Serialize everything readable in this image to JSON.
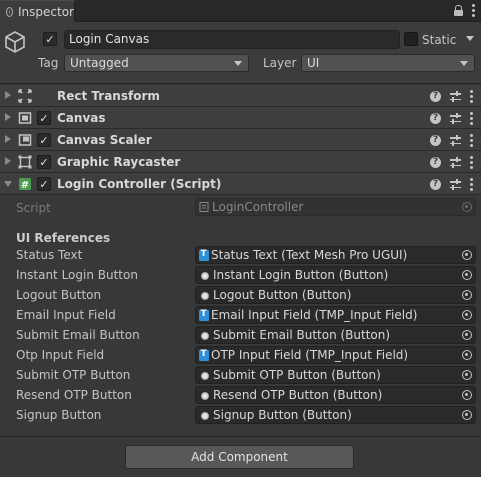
{
  "window": {
    "tab_title": "Inspector"
  },
  "header": {
    "object_name": "Login Canvas",
    "object_active": true,
    "static_label": "Static",
    "static_checked": false,
    "tag_label": "Tag",
    "tag_value": "Untagged",
    "layer_label": "Layer",
    "layer_value": "UI"
  },
  "components": [
    {
      "name": "Rect Transform",
      "icon": "rect-transform-icon",
      "has_checkbox": false,
      "expanded": false
    },
    {
      "name": "Canvas",
      "icon": "canvas-icon",
      "has_checkbox": true,
      "expanded": false
    },
    {
      "name": "Canvas Scaler",
      "icon": "canvas-scaler-icon",
      "has_checkbox": true,
      "expanded": false
    },
    {
      "name": "Graphic Raycaster",
      "icon": "graphic-raycaster-icon",
      "has_checkbox": true,
      "expanded": false
    },
    {
      "name": "Login Controller (Script)",
      "icon": "script-icon",
      "has_checkbox": true,
      "expanded": true
    }
  ],
  "script": {
    "label": "Script",
    "value": "LoginController"
  },
  "ui_references": {
    "title": "UI References",
    "fields": [
      {
        "label": "Status Text",
        "value": "Status Text (Text Mesh Pro UGUI)",
        "icon": "tmp-text-icon"
      },
      {
        "label": "Instant Login Button",
        "value": "Instant Login Button (Button)",
        "icon": "button-icon"
      },
      {
        "label": "Logout Button",
        "value": "Logout Button (Button)",
        "icon": "button-icon"
      },
      {
        "label": "Email Input Field",
        "value": "Email Input Field (TMP_Input Field)",
        "icon": "tmp-text-icon"
      },
      {
        "label": "Submit Email Button",
        "value": "Submit Email Button (Button)",
        "icon": "button-icon"
      },
      {
        "label": "Otp Input Field",
        "value": "OTP Input Field (TMP_Input Field)",
        "icon": "tmp-text-icon"
      },
      {
        "label": "Submit OTP Button",
        "value": "Submit OTP Button (Button)",
        "icon": "button-icon"
      },
      {
        "label": "Resend OTP Button",
        "value": "Resend OTP Button (Button)",
        "icon": "button-icon"
      },
      {
        "label": "Signup Button",
        "value": "Signup Button (Button)",
        "icon": "button-icon"
      }
    ]
  },
  "footer": {
    "add_component_label": "Add Component"
  }
}
